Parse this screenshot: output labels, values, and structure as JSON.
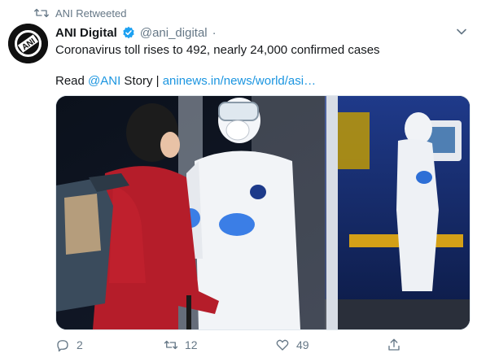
{
  "retweet": {
    "text": "ANI Retweeted",
    "icon": "retweet-icon"
  },
  "tweet": {
    "author_name": "ANI Digital",
    "handle": "@ani_digital",
    "separator": "·",
    "text": "Coronavirus toll rises to 492, nearly 24,000 confirmed cases",
    "read_prefix": "Read ",
    "mention": "@ANI",
    "story_text": " Story | ",
    "link": "aninews.in/news/world/asi…"
  },
  "avatar_label": "ANI",
  "actions": {
    "reply_count": "2",
    "retweet_count": "12",
    "like_count": "49"
  },
  "colors": {
    "link": "#1b95e0",
    "muted": "#657786",
    "text": "#14171a",
    "verified": "#1da1f2"
  }
}
